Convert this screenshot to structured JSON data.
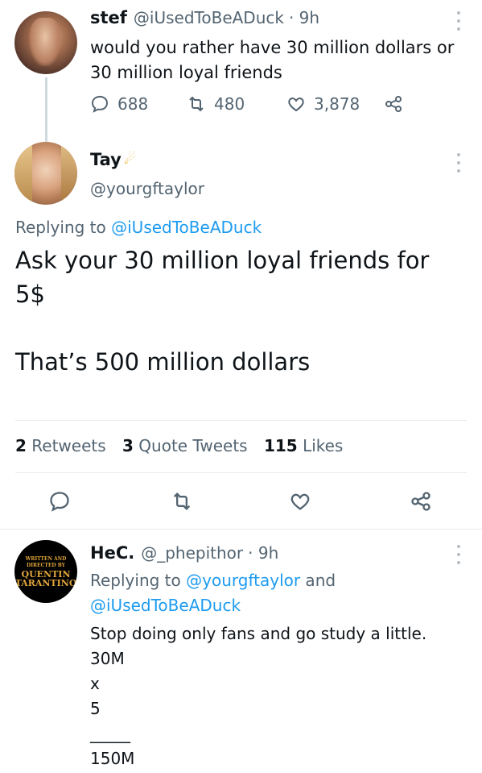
{
  "tweet1": {
    "name": "stef",
    "handle": "@iUsedToBeADuck",
    "time": "· 9h",
    "text_line1": "would you rather have 30 million dollars or",
    "text_line2": "30 million loyal friends",
    "replies": "688",
    "retweets": "480",
    "likes": "3,878"
  },
  "main_tweet": {
    "name": "Tay",
    "handle": "@yourgftaylor",
    "replying_prefix": "Replying to ",
    "replying_to": "@iUsedToBeADuck",
    "text_line1": "Ask your 30 million loyal friends for",
    "text_line2": "5$",
    "text_line3": "That’s 500 million dollars",
    "stats": {
      "retweets_count": "2",
      "retweets_label": "Retweets",
      "quotes_count": "3",
      "quotes_label": "Quote Tweets",
      "likes_count": "115",
      "likes_label": "Likes"
    }
  },
  "reply": {
    "name": "HeC.",
    "handle": "@_phepithor",
    "time": "· 9h",
    "replying_prefix": "Replying to ",
    "replying_to1": "@yourgftaylor",
    "and": " and",
    "replying_to2": "@iUsedToBeADuck",
    "line1": "Stop doing only fans and go study a little.",
    "line2": "30M",
    "line3": "x",
    "line4": "5",
    "line5": "_____",
    "line6": "150M",
    "avatar_text": {
      "written": "WRITTEN AND",
      "directed": "DIRECTED BY",
      "quentin": "QUENTIN",
      "tarantino": "TARANTINO"
    }
  },
  "colors": {
    "accent": "#1d9bf0",
    "secondary": "#536471",
    "divider": "#e6e9eb"
  }
}
